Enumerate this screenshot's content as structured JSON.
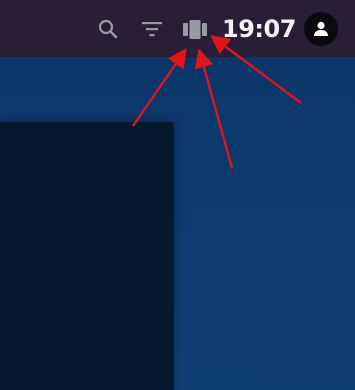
{
  "topbar": {
    "clock": "19:07",
    "icons": [
      "search-icon",
      "filter-icon",
      "view-switcher-icon",
      "user-icon"
    ]
  },
  "colors": {
    "topbar_background": "#2a1e36",
    "desktop_background": "#0c3a6f",
    "panel_background": "#07192e",
    "annotation_arrows": "#e0141b"
  }
}
